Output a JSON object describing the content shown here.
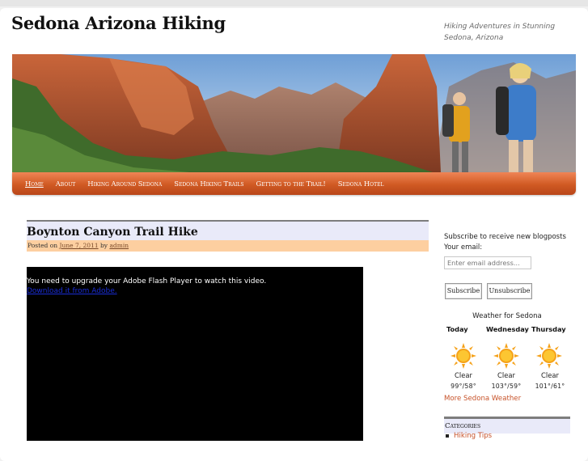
{
  "site": {
    "title": "Sedona Arizona Hiking",
    "tagline": "Hiking Adventures in Stunning Sedona, Arizona"
  },
  "nav": {
    "items": [
      {
        "label": "Home",
        "active": true
      },
      {
        "label": "About"
      },
      {
        "label": "Hiking Around Sedona"
      },
      {
        "label": "Sedona Hiking Trails"
      },
      {
        "label": "Getting to the Trail!"
      },
      {
        "label": "Sedona Hotel"
      }
    ]
  },
  "post": {
    "title": "Boynton Canyon Trail Hike",
    "meta_prefix": "Posted on",
    "date": "June 7, 2011",
    "meta_by": "by",
    "author": "admin",
    "video_message": "You need to upgrade your Adobe Flash Player to watch this video.",
    "video_link": "Download it from Adobe."
  },
  "subscribe": {
    "text": "Subscribe to receive new blogposts",
    "email_label": "Your email:",
    "placeholder": "Enter email address...",
    "subscribe_button": "Subscribe",
    "unsubscribe_button": "Unsubscribe"
  },
  "weather": {
    "title": "Weather for Sedona",
    "days": [
      {
        "day": "Today",
        "condition": "Clear",
        "temps": "99°/58°",
        "icon": "sun-icon"
      },
      {
        "day": "Wednesday",
        "condition": "Clear",
        "temps": "103°/59°",
        "icon": "sun-icon"
      },
      {
        "day": "Thursday",
        "condition": "Clear",
        "temps": "101°/61°",
        "icon": "sun-icon"
      }
    ],
    "more_link": "More Sedona Weather"
  },
  "categories": {
    "title": "Categories",
    "items": [
      "Hiking Tips"
    ]
  },
  "colors": {
    "nav": "#d05a23",
    "link": "#c7532a",
    "post_title_bg": "#e9eaf9",
    "post_meta_bg": "#fdcfa0"
  }
}
